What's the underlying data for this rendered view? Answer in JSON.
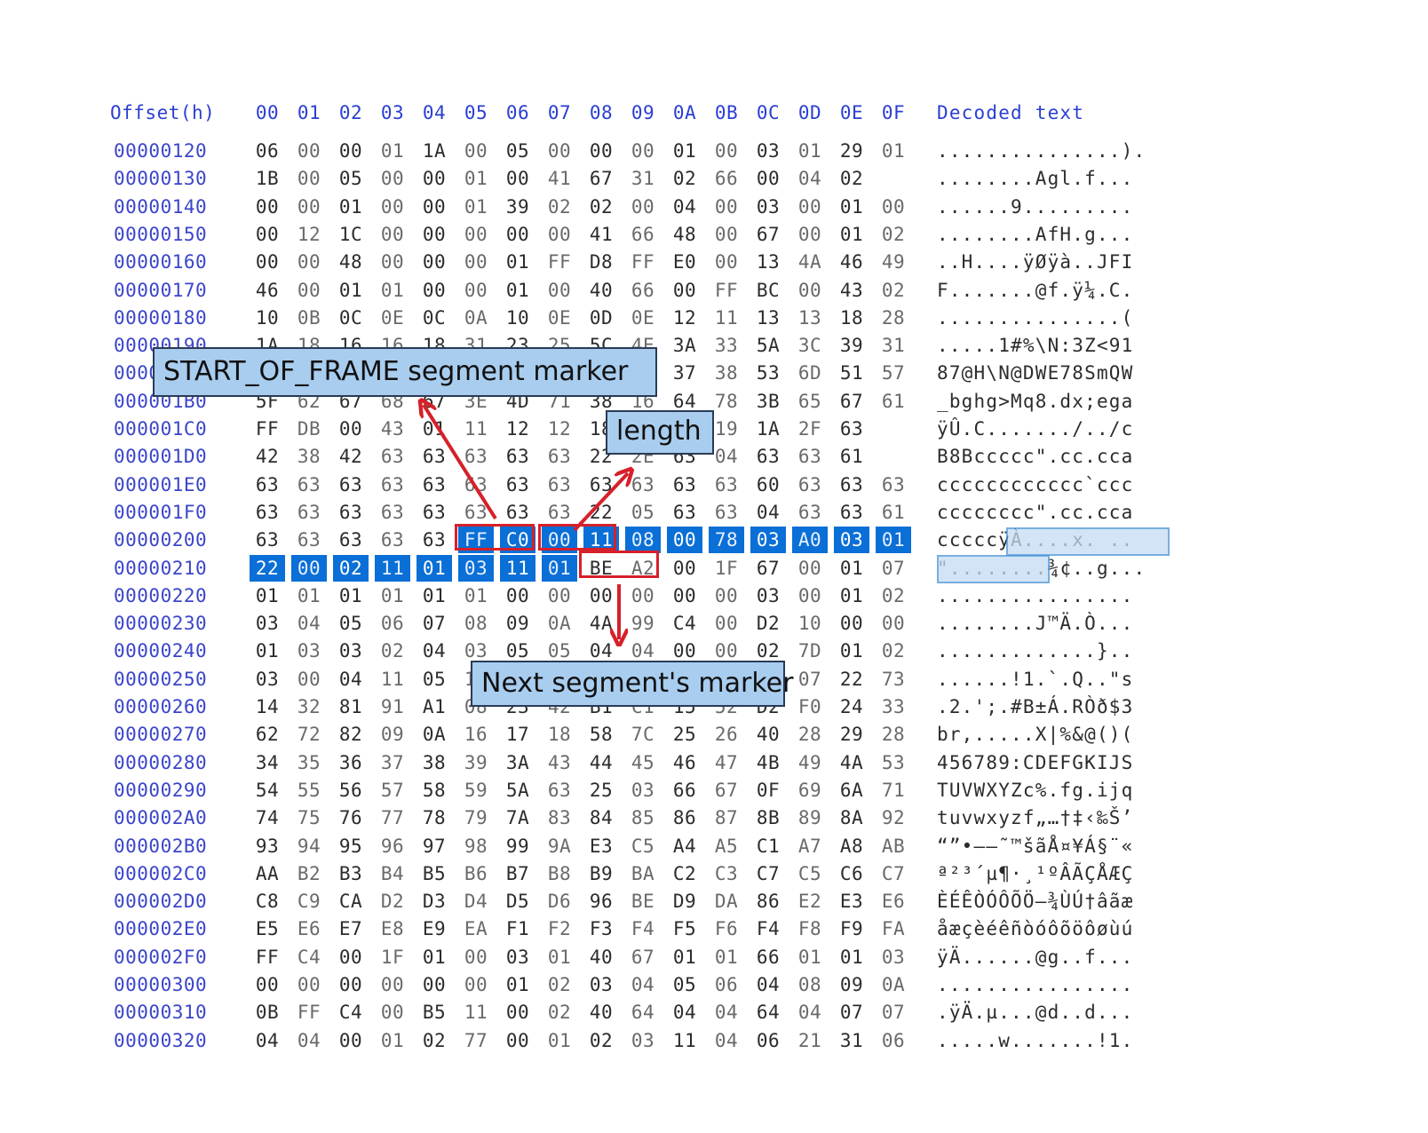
{
  "header": {
    "offset_label": "Offset(h)",
    "columns": [
      "00",
      "01",
      "02",
      "03",
      "04",
      "05",
      "06",
      "07",
      "08",
      "09",
      "0A",
      "0B",
      "0C",
      "0D",
      "0E",
      "0F"
    ],
    "decoded_label": "Decoded text"
  },
  "rows": [
    {
      "offset": "00000120",
      "bytes": [
        "06",
        "00",
        "00",
        "01",
        "1A",
        "00",
        "05",
        "00",
        "00",
        "00",
        "01",
        "00",
        "03",
        "01",
        "29",
        "01"
      ],
      "text": "...............)."
    },
    {
      "offset": "00000130",
      "bytes": [
        "1B",
        "00",
        "05",
        "00",
        "00",
        "01",
        "00",
        "41",
        "67",
        "31",
        "02",
        "66",
        "00",
        "04",
        "02"
      ],
      "text": "........Agl.f..."
    },
    {
      "offset": "00000140",
      "bytes": [
        "00",
        "00",
        "01",
        "00",
        "00",
        "01",
        "39",
        "02",
        "02",
        "00",
        "04",
        "00",
        "03",
        "00",
        "01",
        "00"
      ],
      "text": "......9........."
    },
    {
      "offset": "00000150",
      "bytes": [
        "00",
        "12",
        "1C",
        "00",
        "00",
        "00",
        "00",
        "00",
        "41",
        "66",
        "48",
        "00",
        "67",
        "00",
        "01",
        "02"
      ],
      "text": "........AfH.g..."
    },
    {
      "offset": "00000160",
      "bytes": [
        "00",
        "00",
        "48",
        "00",
        "00",
        "00",
        "01",
        "FF",
        "D8",
        "FF",
        "E0",
        "00",
        "13",
        "4A",
        "46",
        "49"
      ],
      "text": "..H....ÿØÿà..JFI"
    },
    {
      "offset": "00000170",
      "bytes": [
        "46",
        "00",
        "01",
        "01",
        "00",
        "00",
        "01",
        "00",
        "40",
        "66",
        "00",
        "FF",
        "BC",
        "00",
        "43",
        "02"
      ],
      "text": "F.......@f.ÿ¼.C."
    },
    {
      "offset": "00000180",
      "bytes": [
        "10",
        "0B",
        "0C",
        "0E",
        "0C",
        "0A",
        "10",
        "0E",
        "0D",
        "0E",
        "12",
        "11",
        "13",
        "13",
        "18",
        "28"
      ],
      "text": "...............("
    },
    {
      "offset": "00000190",
      "bytes": [
        "1A",
        "18",
        "16",
        "16",
        "18",
        "31",
        "23",
        "25",
        "5C",
        "4E",
        "3A",
        "33",
        "5A",
        "3C",
        "39",
        "31"
      ],
      "text": ".....1#%\\N:3Z<91"
    },
    {
      "offset": "000001A0",
      "bytes": [
        "38",
        "37",
        "40",
        "48",
        "5C",
        "4E",
        "40",
        "44",
        "57",
        "45",
        "37",
        "38",
        "53",
        "6D",
        "51",
        "57"
      ],
      "text": "87@H\\N@DWE78SmQW"
    },
    {
      "offset": "000001B0",
      "bytes": [
        "5F",
        "62",
        "67",
        "68",
        "67",
        "3E",
        "4D",
        "71",
        "38",
        "16",
        "64",
        "78",
        "3B",
        "65",
        "67",
        "61"
      ],
      "text": "_bghg>Mq8.dx;ega"
    },
    {
      "offset": "000001C0",
      "bytes": [
        "FF",
        "DB",
        "00",
        "43",
        "01",
        "11",
        "12",
        "12",
        "18",
        "15",
        "2F",
        "19",
        "1A",
        "2F",
        "63"
      ],
      "text": "ÿÛ.C......./../c"
    },
    {
      "offset": "000001D0",
      "bytes": [
        "42",
        "38",
        "42",
        "63",
        "63",
        "63",
        "63",
        "63",
        "22",
        "2E",
        "63",
        "04",
        "63",
        "63",
        "61"
      ],
      "text": "B8Bccccc\".cc.cca"
    },
    {
      "offset": "000001E0",
      "bytes": [
        "63",
        "63",
        "63",
        "63",
        "63",
        "63",
        "63",
        "63",
        "63",
        "63",
        "63",
        "63",
        "60",
        "63",
        "63",
        "63"
      ],
      "text": "cccccccccccc`ccc"
    },
    {
      "offset": "000001F0",
      "bytes": [
        "63",
        "63",
        "63",
        "63",
        "63",
        "63",
        "63",
        "63",
        "22",
        "05",
        "63",
        "63",
        "04",
        "63",
        "63",
        "61"
      ],
      "text": "cccccccc\".cc.cca"
    },
    {
      "offset": "00000200",
      "bytes": [
        "63",
        "63",
        "63",
        "63",
        "63",
        "FF",
        "C0",
        "00",
        "11",
        "08",
        "00",
        "78",
        "03",
        "A0",
        "03",
        "01"
      ],
      "text": "cccccÿÀ....x. .."
    },
    {
      "offset": "00000210",
      "bytes": [
        "22",
        "00",
        "02",
        "11",
        "01",
        "03",
        "11",
        "01",
        "BE",
        "A2",
        "00",
        "1F",
        "67",
        "00",
        "01",
        "07"
      ],
      "text": "\"........¾¢..g..."
    },
    {
      "offset": "00000220",
      "bytes": [
        "01",
        "01",
        "01",
        "01",
        "01",
        "01",
        "00",
        "00",
        "00",
        "00",
        "00",
        "00",
        "03",
        "00",
        "01",
        "02"
      ],
      "text": "................"
    },
    {
      "offset": "00000230",
      "bytes": [
        "03",
        "04",
        "05",
        "06",
        "07",
        "08",
        "09",
        "0A",
        "4A",
        "99",
        "C4",
        "00",
        "D2",
        "10",
        "00",
        "00"
      ],
      "text": "........J™Ä.Ò..."
    },
    {
      "offset": "00000240",
      "bytes": [
        "01",
        "03",
        "03",
        "02",
        "04",
        "03",
        "05",
        "05",
        "04",
        "04",
        "00",
        "00",
        "02",
        "7D",
        "01",
        "02"
      ],
      "text": ".............}.."
    },
    {
      "offset": "00000250",
      "bytes": [
        "03",
        "00",
        "04",
        "11",
        "05",
        "12",
        "21",
        "31",
        "41",
        "06",
        "13",
        "51",
        "61",
        "07",
        "22",
        "73"
      ],
      "text": "......!1.`.Q..\"s"
    },
    {
      "offset": "00000260",
      "bytes": [
        "14",
        "32",
        "81",
        "91",
        "A1",
        "08",
        "23",
        "42",
        "B1",
        "C1",
        "15",
        "52",
        "D2",
        "F0",
        "24",
        "33"
      ],
      "text": ".2.';.#B±Á.RÒð$3"
    },
    {
      "offset": "00000270",
      "bytes": [
        "62",
        "72",
        "82",
        "09",
        "0A",
        "16",
        "17",
        "18",
        "58",
        "7C",
        "25",
        "26",
        "40",
        "28",
        "29",
        "28"
      ],
      "text": "br,.....X|%&@()("
    },
    {
      "offset": "00000280",
      "bytes": [
        "34",
        "35",
        "36",
        "37",
        "38",
        "39",
        "3A",
        "43",
        "44",
        "45",
        "46",
        "47",
        "4B",
        "49",
        "4A",
        "53"
      ],
      "text": "456789:CDEFGKIJS"
    },
    {
      "offset": "00000290",
      "bytes": [
        "54",
        "55",
        "56",
        "57",
        "58",
        "59",
        "5A",
        "63",
        "25",
        "03",
        "66",
        "67",
        "0F",
        "69",
        "6A",
        "71"
      ],
      "text": "TUVWXYZc%.fg.ijq"
    },
    {
      "offset": "000002A0",
      "bytes": [
        "74",
        "75",
        "76",
        "77",
        "78",
        "79",
        "7A",
        "83",
        "84",
        "85",
        "86",
        "87",
        "8B",
        "89",
        "8A",
        "92"
      ],
      "text": "tuvwxyzf„…†‡‹‰Š’"
    },
    {
      "offset": "000002B0",
      "bytes": [
        "93",
        "94",
        "95",
        "96",
        "97",
        "98",
        "99",
        "9A",
        "E3",
        "C5",
        "A4",
        "A5",
        "C1",
        "A7",
        "A8",
        "AB"
      ],
      "text": "“”•–—˜™šãÅ¤¥Á§¨«"
    },
    {
      "offset": "000002C0",
      "bytes": [
        "AA",
        "B2",
        "B3",
        "B4",
        "B5",
        "B6",
        "B7",
        "B8",
        "B9",
        "BA",
        "C2",
        "C3",
        "C7",
        "C5",
        "C6",
        "C7"
      ],
      "text": "ª²³´µ¶·¸¹ºÂÃÇÅÆÇ"
    },
    {
      "offset": "000002D0",
      "bytes": [
        "C8",
        "C9",
        "CA",
        "D2",
        "D3",
        "D4",
        "D5",
        "D6",
        "96",
        "BE",
        "D9",
        "DA",
        "86",
        "E2",
        "E3",
        "E6"
      ],
      "text": "ÈÉÊÒÓÔÕÖ–¾ÙÚ†âãæ"
    },
    {
      "offset": "000002E0",
      "bytes": [
        "E5",
        "E6",
        "E7",
        "E8",
        "E9",
        "EA",
        "F1",
        "F2",
        "F3",
        "F4",
        "F5",
        "F6",
        "F4",
        "F8",
        "F9",
        "FA"
      ],
      "text": "åæçèéêñòóôõöôøùú"
    },
    {
      "offset": "000002F0",
      "bytes": [
        "FF",
        "C4",
        "00",
        "1F",
        "01",
        "00",
        "03",
        "01",
        "40",
        "67",
        "01",
        "01",
        "66",
        "01",
        "01",
        "03"
      ],
      "text": "ÿÄ......@g..f..."
    },
    {
      "offset": "00000300",
      "bytes": [
        "00",
        "00",
        "00",
        "00",
        "00",
        "00",
        "01",
        "02",
        "03",
        "04",
        "05",
        "06",
        "04",
        "08",
        "09",
        "0A"
      ],
      "text": "................"
    },
    {
      "offset": "00000310",
      "bytes": [
        "0B",
        "FF",
        "C4",
        "00",
        "B5",
        "11",
        "00",
        "02",
        "40",
        "64",
        "04",
        "04",
        "64",
        "04",
        "07",
        "07"
      ],
      "text": ".ÿÄ.µ...@d..d..."
    },
    {
      "offset": "00000320",
      "bytes": [
        "04",
        "04",
        "00",
        "01",
        "02",
        "77",
        "00",
        "01",
        "02",
        "03",
        "11",
        "04",
        "06",
        "21",
        "31",
        "06"
      ],
      "text": ".....w.......!1."
    }
  ],
  "annotations": {
    "sof_label": "START_OF_FRAME segment marker",
    "length_label": "length",
    "next_label": "Next segment's marker"
  },
  "colors": {
    "header_blue": "#2a3fd0",
    "selection_blue": "#0a6fd6",
    "annotation_red": "#d6202a",
    "label_fill": "#a8cdef"
  }
}
